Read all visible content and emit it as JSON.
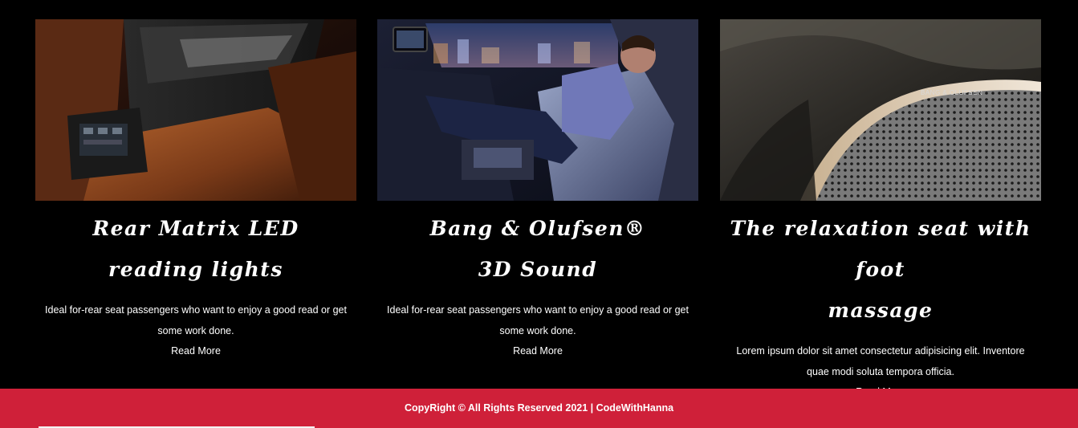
{
  "cards": [
    {
      "title_line1": "Rear Matrix LED",
      "title_line2": "reading lights",
      "text": "Ideal for-rear seat passengers who want to enjoy a good read or get some work done.",
      "link": "Read More"
    },
    {
      "title_line1": "Bang & Olufsen®",
      "title_line2": "3D Sound",
      "text": "Ideal for-rear seat passengers who want to enjoy a good read or get some work done.",
      "link": "Read More"
    },
    {
      "title_line1": "The relaxation seat with foot",
      "title_line2": "massage",
      "text": "Lorem ipsum dolor sit amet consectetur adipisicing elit. Inventore quae modi soluta tempora officia.",
      "link": "Read More",
      "image_brand_text": "BANG & OLUFSEN"
    }
  ],
  "footer": {
    "text": "CopyRight © All Rights Reserved 2021 | CodeWithHanna"
  },
  "colors": {
    "background": "#000000",
    "footer_accent": "#cf2039",
    "text": "#ffffff"
  }
}
